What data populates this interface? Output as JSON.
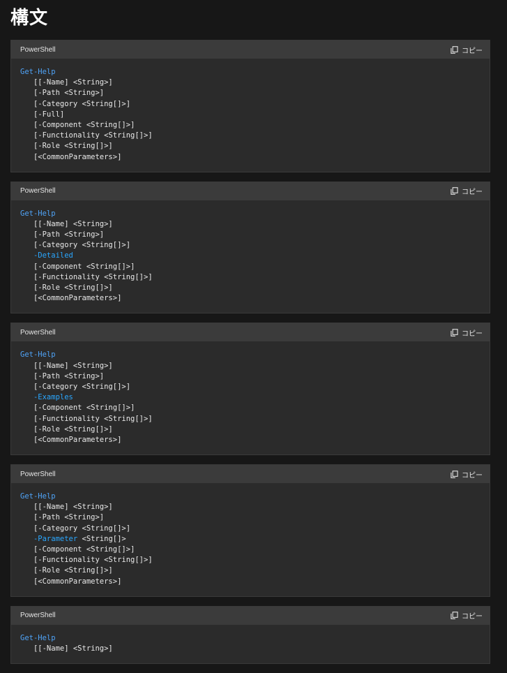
{
  "page": {
    "title": "構文"
  },
  "blocks": [
    {
      "language": "PowerShell",
      "copy_label": "コピー",
      "lines": [
        {
          "kind": "cmd",
          "text": "Get-Help"
        },
        {
          "kind": "param",
          "text": "   [[-Name] <String>]"
        },
        {
          "kind": "param",
          "text": "   [-Path <String>]"
        },
        {
          "kind": "param",
          "text": "   [-Category <String[]>]"
        },
        {
          "kind": "param",
          "text": "   [-Full]"
        },
        {
          "kind": "param",
          "text": "   [-Component <String[]>]"
        },
        {
          "kind": "param",
          "text": "   [-Functionality <String[]>]"
        },
        {
          "kind": "param",
          "text": "   [-Role <String[]>]"
        },
        {
          "kind": "param",
          "text": "   [<CommonParameters>]"
        }
      ]
    },
    {
      "language": "PowerShell",
      "copy_label": "コピー",
      "lines": [
        {
          "kind": "cmd",
          "text": "Get-Help"
        },
        {
          "kind": "param",
          "text": "   [[-Name] <String>]"
        },
        {
          "kind": "param",
          "text": "   [-Path <String>]"
        },
        {
          "kind": "param",
          "text": "   [-Category <String[]>]"
        },
        {
          "kind": "switch",
          "text": "   -Detailed"
        },
        {
          "kind": "param",
          "text": "   [-Component <String[]>]"
        },
        {
          "kind": "param",
          "text": "   [-Functionality <String[]>]"
        },
        {
          "kind": "param",
          "text": "   [-Role <String[]>]"
        },
        {
          "kind": "param",
          "text": "   [<CommonParameters>]"
        }
      ]
    },
    {
      "language": "PowerShell",
      "copy_label": "コピー",
      "lines": [
        {
          "kind": "cmd",
          "text": "Get-Help"
        },
        {
          "kind": "param",
          "text": "   [[-Name] <String>]"
        },
        {
          "kind": "param",
          "text": "   [-Path <String>]"
        },
        {
          "kind": "param",
          "text": "   [-Category <String[]>]"
        },
        {
          "kind": "switch",
          "text": "   -Examples"
        },
        {
          "kind": "param",
          "text": "   [-Component <String[]>]"
        },
        {
          "kind": "param",
          "text": "   [-Functionality <String[]>]"
        },
        {
          "kind": "param",
          "text": "   [-Role <String[]>]"
        },
        {
          "kind": "param",
          "text": "   [<CommonParameters>]"
        }
      ]
    },
    {
      "language": "PowerShell",
      "copy_label": "コピー",
      "lines": [
        {
          "kind": "cmd",
          "text": "Get-Help"
        },
        {
          "kind": "param",
          "text": "   [[-Name] <String>]"
        },
        {
          "kind": "param",
          "text": "   [-Path <String>]"
        },
        {
          "kind": "param",
          "text": "   [-Category <String[]>]"
        },
        {
          "kind": "switch",
          "text": "   -Parameter",
          "tail": " <String[]>"
        },
        {
          "kind": "param",
          "text": "   [-Component <String[]>]"
        },
        {
          "kind": "param",
          "text": "   [-Functionality <String[]>]"
        },
        {
          "kind": "param",
          "text": "   [-Role <String[]>]"
        },
        {
          "kind": "param",
          "text": "   [<CommonParameters>]"
        }
      ]
    },
    {
      "language": "PowerShell",
      "copy_label": "コピー",
      "lines": [
        {
          "kind": "cmd",
          "text": "Get-Help"
        },
        {
          "kind": "param",
          "text": "   [[-Name] <String>]"
        }
      ]
    }
  ],
  "icons": {
    "copy": "copy-icon"
  },
  "colors": {
    "background": "#171717",
    "block_body": "#2b2b2b",
    "block_header": "#3b3b3b",
    "command": "#4fa3f7",
    "switch": "#2aa7ff",
    "text": "#e8e8e8"
  }
}
